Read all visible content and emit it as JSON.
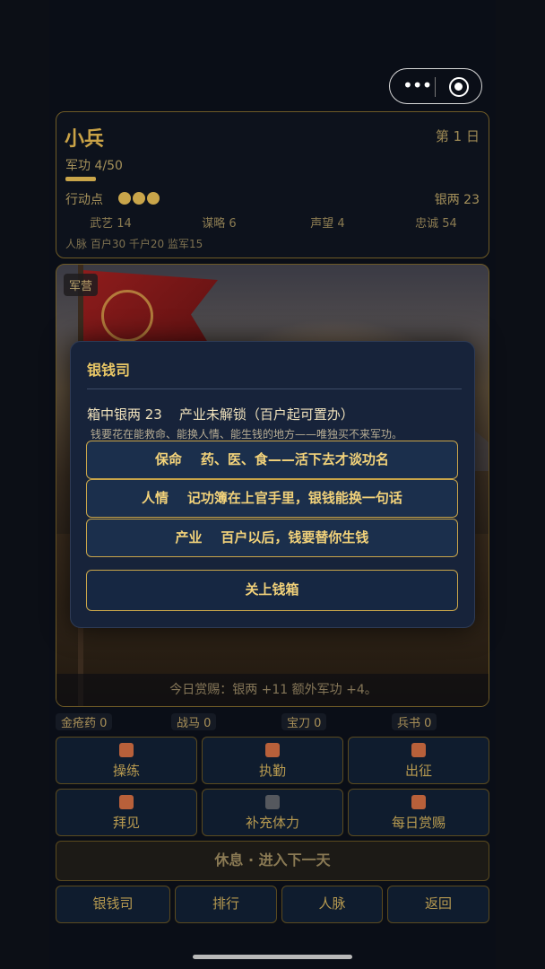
{
  "capsule": {
    "more_glyph": "•••"
  },
  "status": {
    "rank": "小兵",
    "day": "第 1 日",
    "merit": "军功 4/50",
    "merit_progress": 0.08,
    "action_points_label": "行动点",
    "action_points": 3,
    "silver": "银两 23",
    "stats": [
      "武艺 14",
      "谋略 6",
      "声望 4",
      "忠诚 54"
    ],
    "network": "人脉 百户30 千户20 监军15"
  },
  "scene": {
    "tag": "军营",
    "reward_text": "今日赏赐：银两 +11 额外军功 +4。"
  },
  "modal": {
    "title": "银钱司",
    "status_line": "箱中银两 23    产业未解锁（百户起可置办）",
    "tip": "钱要花在能救命、能换人情、能生钱的地方——唯独买不来军功。",
    "options": [
      "保命    药、医、食——活下去才谈功名",
      "人情    记功簿在上官手里，银钱能换一句话",
      "产业    百户以后，钱要替你生钱"
    ],
    "close_label": "关上钱箱"
  },
  "inventory": [
    "金疮药 0",
    "战马 0",
    "宝刀 0",
    "兵书 0"
  ],
  "actions": [
    {
      "label": "操练",
      "icon": "training-icon"
    },
    {
      "label": "执勤",
      "icon": "duty-icon"
    },
    {
      "label": "出征",
      "icon": "campaign-icon"
    },
    {
      "label": "拜见",
      "icon": "visit-icon"
    },
    {
      "label": "补充体力",
      "icon": "stamina-icon"
    },
    {
      "label": "每日赏赐",
      "icon": "daily-reward-icon"
    }
  ],
  "rest_button": "休息 · 进入下一天",
  "nav": [
    "银钱司",
    "排行",
    "人脉",
    "返回"
  ],
  "colors": {
    "accent": "#c9a54a",
    "modal_bg": "#17233a",
    "button_bg": "#1b2f4c"
  }
}
